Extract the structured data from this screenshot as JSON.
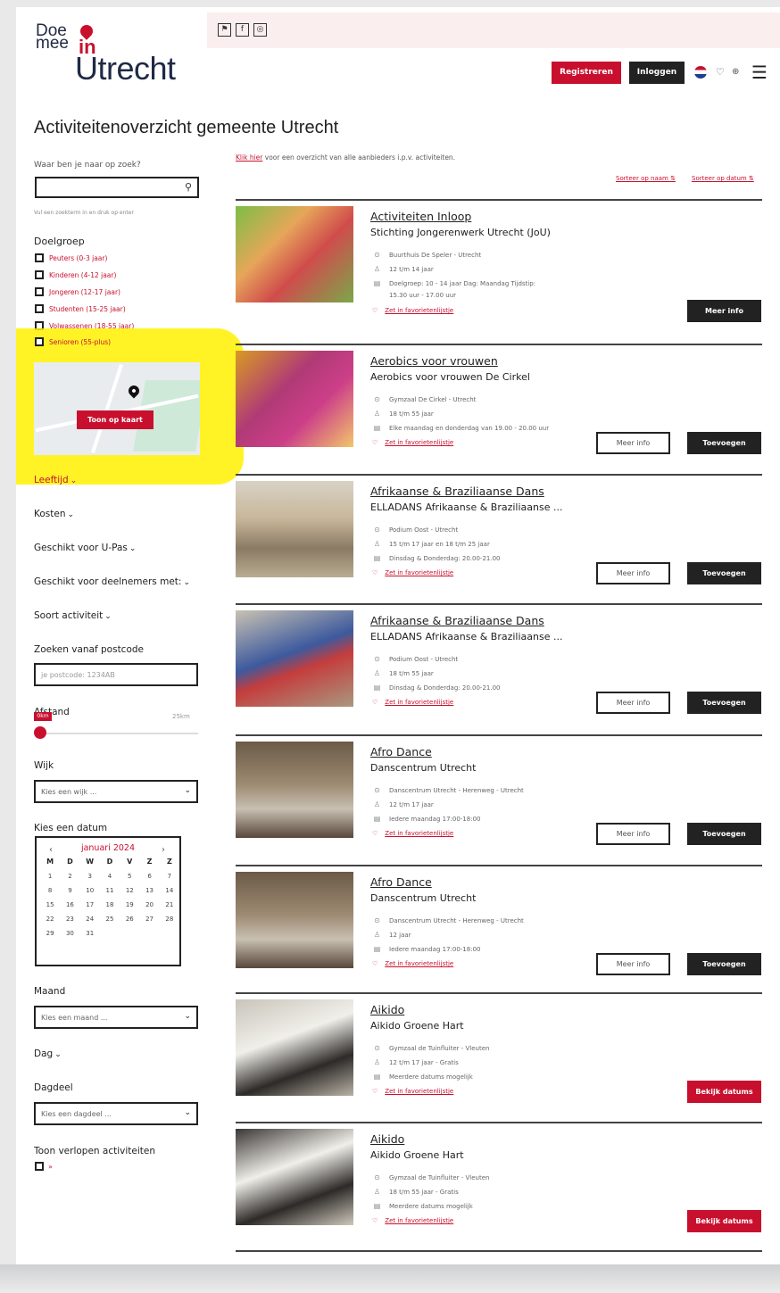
{
  "header": {
    "logo_doe": "Doe",
    "logo_mee": "mee",
    "logo_in": "in",
    "logo_city": "Utrecht",
    "social_icons": [
      "accessibility-icon",
      "facebook-icon",
      "instagram-icon"
    ],
    "register_label": "Registreren",
    "login_label": "Inloggen",
    "language": "NL",
    "accent_color": "#c8102e"
  },
  "page_title": "Activiteitenoverzicht gemeente Utrecht",
  "sidebar": {
    "search_label": "Waar ben je naar op zoek?",
    "search_hint": "Vul een zoekterm in en druk op enter",
    "doelgroep_title": "Doelgroep",
    "doelgroepen": [
      "Peuters (0-3 jaar)",
      "Kinderen (4-12 jaar)",
      "Jongeren (12-17 jaar)",
      "Studenten (15-25 jaar)",
      "Volwassenen (18-55 jaar)",
      "Senioren (55-plus)"
    ],
    "map_button": "Toon op kaart",
    "filters": {
      "leeftijd": "Leeftijd",
      "kosten": "Kosten",
      "upas": "Geschikt voor U-Pas",
      "deelnemers": "Geschikt voor deelnemers met:",
      "soort": "Soort activiteit",
      "postcode_title": "Zoeken vanaf postcode",
      "postcode_placeholder": "je postcode: 1234AB",
      "afstand": "Afstand",
      "afstand_value": "0km",
      "afstand_max": "25km",
      "wijk": "Wijk",
      "wijk_placeholder": "Kies een wijk ...",
      "datum": "Kies een datum",
      "maand": "Maand",
      "maand_placeholder": "Kies een maand ...",
      "dag": "Dag",
      "dagdeel": "Dagdeel",
      "dagdeel_placeholder": "Kies een dagdeel ...",
      "verlopen": "Toon verlopen activiteiten"
    },
    "calendar": {
      "month": "januari 2024",
      "prev": "‹",
      "next": "›",
      "day_headers": [
        "M",
        "D",
        "W",
        "D",
        "V",
        "Z",
        "Z"
      ],
      "days": [
        "1",
        "2",
        "3",
        "4",
        "5",
        "6",
        "7",
        "8",
        "9",
        "10",
        "11",
        "12",
        "13",
        "14",
        "15",
        "16",
        "17",
        "18",
        "19",
        "20",
        "21",
        "22",
        "23",
        "24",
        "25",
        "26",
        "27",
        "28",
        "29",
        "30",
        "31"
      ]
    }
  },
  "main": {
    "intro_link": "Klik hier",
    "intro_text": "voor een overzicht van alle aanbieders i.p.v. activiteiten.",
    "sort_name": "Sorteer op naam ⇅",
    "sort_date": "Sorteer op datum ⇅",
    "fav_label": "Zet in favorietenlijstje",
    "more_info": "Meer info",
    "add": "Toevoegen",
    "dates": "Bekijk datums",
    "cards": [
      {
        "title": "Activiteiten Inloop",
        "subtitle": "Stichting Jongerenwerk Utrecht (JoU)",
        "location": "Buurthuis De Speler - Utrecht",
        "age": "12 t/m 14 jaar",
        "when": "Doelgroep: 10 - 14 jaar Dag: Maandag Tijdstip:",
        "when2": "15.30 uur - 17.00 uur",
        "buttons": "info"
      },
      {
        "title": "Aerobics voor vrouwen",
        "subtitle": "Aerobics voor vrouwen De Cirkel",
        "location": "Gymzaal De Cirkel - Utrecht",
        "age": "18 t/m 55 jaar",
        "when": "Elke maandag en donderdag van 19.00 - 20.00 uur",
        "buttons": "both"
      },
      {
        "title": "Afrikaanse & Braziliaanse Dans",
        "subtitle": "ELLADANS Afrikaanse & Braziliaanse ...",
        "location": "Podium Oost - Utrecht",
        "age": "15 t/m 17 jaar en 18 t/m 25 jaar",
        "when": "Dinsdag & Donderdag: 20.00-21.00",
        "buttons": "both"
      },
      {
        "title": "Afrikaanse & Braziliaanse Dans",
        "subtitle": "ELLADANS Afrikaanse & Braziliaanse ...",
        "location": "Podium Oost - Utrecht",
        "age": "18 t/m 55 jaar",
        "when": "Dinsdag & Donderdag: 20.00-21.00",
        "buttons": "both"
      },
      {
        "title": "Afro Dance",
        "subtitle": "Danscentrum Utrecht",
        "location": "Danscentrum Utrecht - Herenweg - Utrecht",
        "age": "12 t/m 17 jaar",
        "when": "Iedere maandag 17:00-18:00",
        "buttons": "both"
      },
      {
        "title": "Afro Dance",
        "subtitle": "Danscentrum Utrecht",
        "location": "Danscentrum Utrecht - Herenweg - Utrecht",
        "age": "12 jaar",
        "when": "Iedere maandag 17:00-18:00",
        "buttons": "both"
      },
      {
        "title": "Aikido",
        "subtitle": "Aikido Groene Hart",
        "location": "Gymzaal de Tuinfluiter - Vleuten",
        "age": "12 t/m 17 jaar - Gratis",
        "when": "Meerdere datums mogelijk",
        "buttons": "dates"
      },
      {
        "title": "Aikido",
        "subtitle": "Aikido Groene Hart",
        "location": "Gymzaal de Tuinfluiter - Vleuten",
        "age": "18 t/m 55 jaar - Gratis",
        "when": "Meerdere datums mogelijk",
        "buttons": "dates"
      }
    ]
  }
}
